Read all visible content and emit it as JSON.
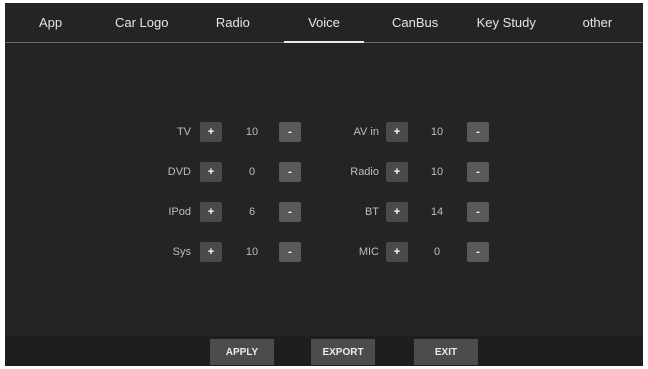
{
  "tabs": [
    {
      "label": "App"
    },
    {
      "label": "Car Logo"
    },
    {
      "label": "Radio"
    },
    {
      "label": "Voice"
    },
    {
      "label": "CanBus"
    },
    {
      "label": "Key Study"
    },
    {
      "label": "other"
    }
  ],
  "active_tab": "Voice",
  "volume": {
    "plus_symbol": "+",
    "minus_symbol": "-",
    "left": [
      {
        "label": "TV",
        "value": "10"
      },
      {
        "label": "DVD",
        "value": "0"
      },
      {
        "label": "IPod",
        "value": "6"
      },
      {
        "label": "Sys",
        "value": "10"
      }
    ],
    "right": [
      {
        "label": "AV in",
        "value": "10"
      },
      {
        "label": "Radio",
        "value": "10"
      },
      {
        "label": "BT",
        "value": "14"
      },
      {
        "label": "MIC",
        "value": "0"
      }
    ]
  },
  "actions": {
    "apply": "APPLY",
    "export": "EXPORT",
    "exit": "EXIT"
  }
}
